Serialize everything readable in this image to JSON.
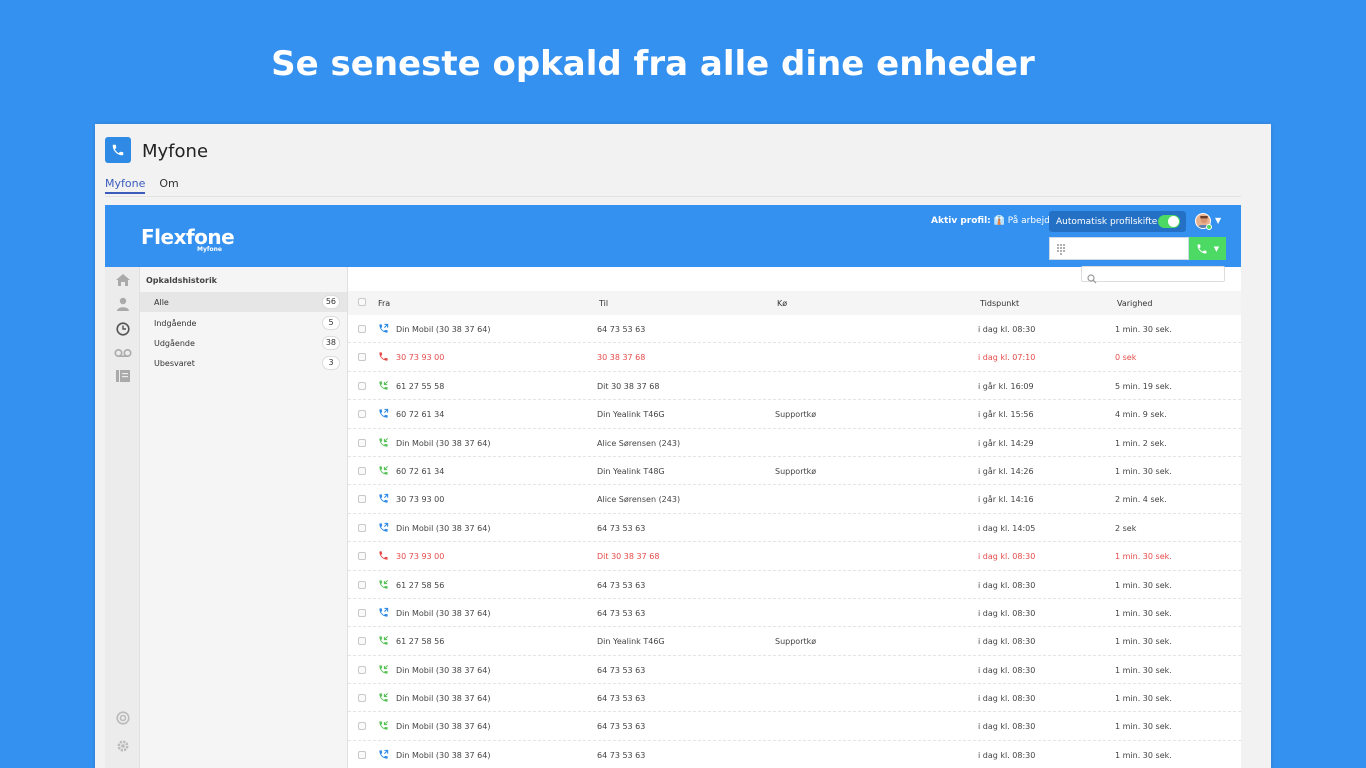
{
  "headline": "Se seneste opkald fra alle dine enheder",
  "window": {
    "title": "Myfone",
    "tabs": [
      {
        "label": "Myfone",
        "active": true
      },
      {
        "label": "Om",
        "active": false
      }
    ]
  },
  "topbar": {
    "brand": "Flexfone",
    "brand_sub": "Myfone",
    "profile_label": "Aktiv profil:",
    "profile_value": "På arbejde",
    "auto_switch_label": "Automatisk profilskifte",
    "auto_switch_on": true
  },
  "sidebar": {
    "title": "Opkaldshistorik",
    "items": [
      {
        "label": "Alle",
        "count": "56",
        "active": true
      },
      {
        "label": "Indgående",
        "count": "5",
        "active": false
      },
      {
        "label": "Udgående",
        "count": "38",
        "active": false
      },
      {
        "label": "Ubesvaret",
        "count": "3",
        "active": false
      }
    ]
  },
  "table": {
    "headers": {
      "fra": "Fra",
      "til": "Til",
      "koe": "Kø",
      "tid": "Tidspunkt",
      "varighed": "Varighed"
    },
    "rows": [
      {
        "dir": "out",
        "fra": "Din Mobil (30 38 37 64)",
        "til": "64 73 53 63",
        "koe": "",
        "tid": "i dag kl. 08:30",
        "varighed": "1 min. 30 sek.",
        "missed": false
      },
      {
        "dir": "missed",
        "fra": "30 73 93 00",
        "til": "30 38 37 68",
        "koe": "",
        "tid": "i dag kl. 07:10",
        "varighed": "0 sek",
        "missed": true
      },
      {
        "dir": "in",
        "fra": "61 27 55 58",
        "til": "Dit 30 38 37 68",
        "koe": "",
        "tid": "i går kl. 16:09",
        "varighed": "5 min. 19 sek.",
        "missed": false
      },
      {
        "dir": "out",
        "fra": "60 72 61 34",
        "til": "Din Yealink T46G",
        "koe": "Supportkø",
        "tid": "i går kl. 15:56",
        "varighed": "4 min. 9 sek.",
        "missed": false
      },
      {
        "dir": "in",
        "fra": "Din Mobil (30 38 37 64)",
        "til": "Alice Sørensen (243)",
        "koe": "",
        "tid": "i går kl. 14:29",
        "varighed": "1 min. 2 sek.",
        "missed": false
      },
      {
        "dir": "in",
        "fra": "60 72 61 34",
        "til": "Din Yealink T48G",
        "koe": "Supportkø",
        "tid": "i går kl. 14:26",
        "varighed": "1 min. 30 sek.",
        "missed": false
      },
      {
        "dir": "out",
        "fra": "30 73 93 00",
        "til": "Alice Sørensen (243)",
        "koe": "",
        "tid": "i går kl. 14:16",
        "varighed": "2 min. 4 sek.",
        "missed": false
      },
      {
        "dir": "out",
        "fra": "Din Mobil (30 38 37 64)",
        "til": "64 73 53 63",
        "koe": "",
        "tid": "i dag kl. 14:05",
        "varighed": "2 sek",
        "missed": false
      },
      {
        "dir": "missed",
        "fra": "30 73 93 00",
        "til": "Dit 30 38 37 68",
        "koe": "",
        "tid": "i dag kl. 08:30",
        "varighed": "1 min. 30 sek.",
        "missed": true
      },
      {
        "dir": "in",
        "fra": "61 27 58 56",
        "til": "64 73 53 63",
        "koe": "",
        "tid": "i dag kl. 08:30",
        "varighed": "1 min. 30 sek.",
        "missed": false
      },
      {
        "dir": "out",
        "fra": "Din Mobil (30 38 37 64)",
        "til": "64 73 53 63",
        "koe": "",
        "tid": "i dag kl. 08:30",
        "varighed": "1 min. 30 sek.",
        "missed": false
      },
      {
        "dir": "in",
        "fra": "61 27 58 56",
        "til": "Din Yealink T46G",
        "koe": "Supportkø",
        "tid": "i dag kl. 08:30",
        "varighed": "1 min. 30 sek.",
        "missed": false
      },
      {
        "dir": "in",
        "fra": "Din Mobil (30 38 37 64)",
        "til": "64 73 53 63",
        "koe": "",
        "tid": "i dag kl. 08:30",
        "varighed": "1 min. 30 sek.",
        "missed": false
      },
      {
        "dir": "in",
        "fra": "Din Mobil (30 38 37 64)",
        "til": "64 73 53 63",
        "koe": "",
        "tid": "i dag kl. 08:30",
        "varighed": "1 min. 30 sek.",
        "missed": false
      },
      {
        "dir": "in",
        "fra": "Din Mobil (30 38 37 64)",
        "til": "64 73 53 63",
        "koe": "",
        "tid": "i dag kl. 08:30",
        "varighed": "1 min. 30 sek.",
        "missed": false
      },
      {
        "dir": "out",
        "fra": "Din Mobil (30 38 37 64)",
        "til": "64 73 53 63",
        "koe": "",
        "tid": "i dag kl. 08:30",
        "varighed": "1 min. 30 sek.",
        "missed": false
      }
    ]
  },
  "colors": {
    "accent": "#3591ef",
    "missed": "#e54b4b",
    "incoming": "#5ac25a",
    "outgoing": "#2f8ae6",
    "toggle": "#4cd964"
  }
}
